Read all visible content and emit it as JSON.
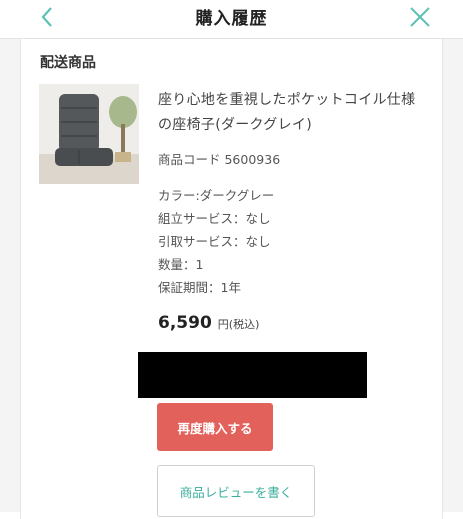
{
  "header": {
    "title": "購入履歴",
    "back_icon": "chevron-left-icon",
    "close_icon": "close-icon",
    "accent_color": "#5ec2b3"
  },
  "section": {
    "title": "配送商品"
  },
  "product": {
    "name": "座り心地を重視したポケットコイル仕様の座椅子(ダークグレイ)",
    "code": "商品コード 5600936",
    "attributes": [
      "カラー:ダークグレー",
      "組立サービス：なし",
      "引取サービス：なし",
      "数量：1",
      "保証期間：1年"
    ],
    "price": "6,590",
    "price_unit": "円(税込)"
  },
  "actions": {
    "reorder_label": "再度購入する",
    "reorder_color": "#e2615a",
    "review_label": "商品レビューを書く",
    "review_color": "#3aae9c"
  }
}
